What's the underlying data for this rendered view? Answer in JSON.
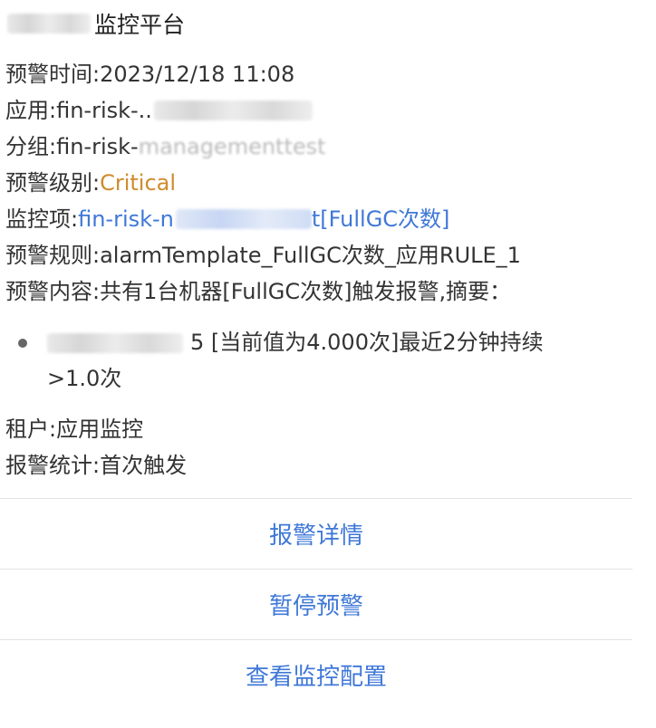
{
  "header": {
    "title": "监控平台"
  },
  "alert": {
    "time_label": "预警时间: ",
    "time_value": "2023/12/18 11:08",
    "app_label": "应用: ",
    "app_value": "fin-risk-..",
    "group_label": "分组: ",
    "group_value": "fin-risk-",
    "group_value_tail": "managementtest",
    "level_label": "预警级别: ",
    "level_value": "Critical",
    "item_label": "监控项: ",
    "item_value_prefix": "fin-risk-n",
    "item_value_suffix": "t[FullGC次数]",
    "rule_label": "预警规则: ",
    "rule_value": "alarmTemplate_FullGC次数_应用RULE_1",
    "content_label": "预警内容: ",
    "content_value": "共有1台机器[FullGC次数]触发报警,摘要："
  },
  "summary": {
    "bullet_text": "5 [当前值为4.000次]最近2分钟持续",
    "bullet_text_line2": ">1.0次"
  },
  "meta": {
    "tenant_label": "租户: ",
    "tenant_value": "应用监控",
    "stats_label": "报警统计: ",
    "stats_value": "首次触发"
  },
  "actions": {
    "detail_label": "报警详情",
    "pause_label": "暂停预警",
    "config_label": "查看监控配置"
  },
  "colors": {
    "link": "#3f78d8",
    "critical": "#d08a2e"
  }
}
